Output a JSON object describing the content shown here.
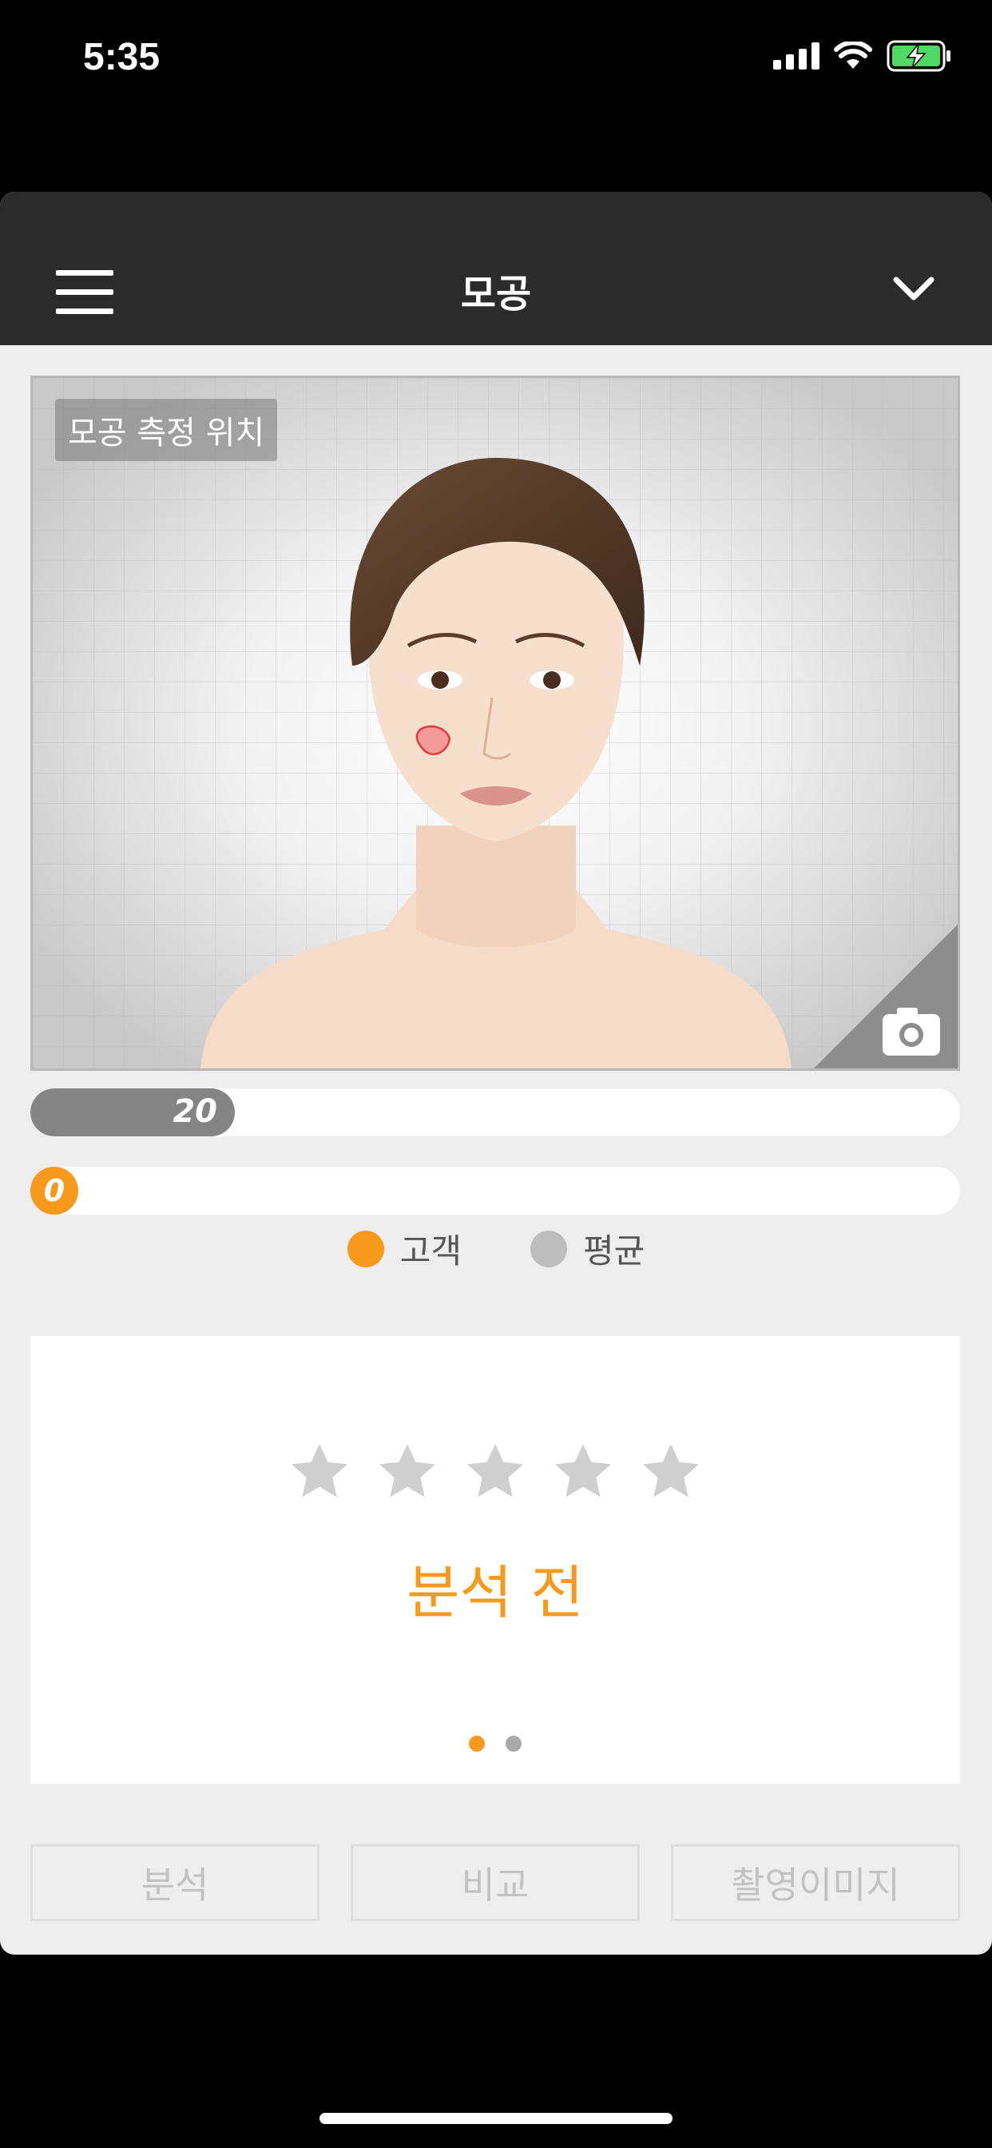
{
  "status_bar": {
    "time": "5:35",
    "icons": [
      "signal-icon",
      "wifi-icon",
      "battery-charging-icon"
    ]
  },
  "header": {
    "title": "모공",
    "menu_icon": "hamburger-menu-icon",
    "dropdown_icon": "chevron-down-icon"
  },
  "face_panel": {
    "label": "모공 측정 위치",
    "camera_icon": "camera-icon"
  },
  "gauge": {
    "average": {
      "value": "20",
      "fraction": 0.22
    },
    "customer": {
      "value": "0",
      "fraction": 0.0
    }
  },
  "legend": [
    {
      "label": "고객",
      "color": "#f7991c"
    },
    {
      "label": "평균",
      "color": "#bdbdbd"
    }
  ],
  "result": {
    "rating": 0,
    "rating_max": 5,
    "status_text": "분석 전",
    "pages": 2,
    "active_page": 1
  },
  "buttons": {
    "analyze": "분석",
    "compare": "비교",
    "captured_images": "촬영이미지"
  },
  "colors": {
    "accent": "#f7991c",
    "header_bg": "#2b2b2b",
    "avg_bar": "#848484",
    "star_empty": "#cfcfcf"
  }
}
